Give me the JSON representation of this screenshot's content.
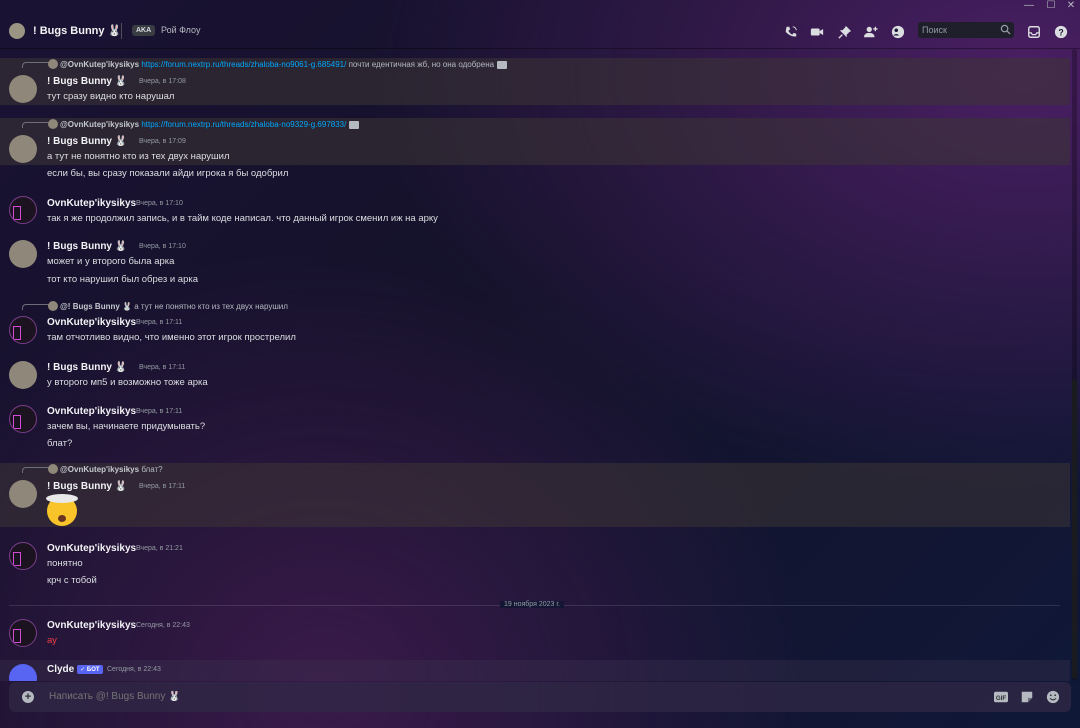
{
  "window": {
    "minimize": "—",
    "maximize": "☐",
    "close": "✕"
  },
  "header": {
    "name": "! Bugs Bunny 🐰",
    "aka_badge": "AKA",
    "alias": "Рой Флоу",
    "icons": [
      "phone-call-icon",
      "video-call-icon",
      "pin-icon",
      "add-friend-icon",
      "profile-icon",
      "inbox-icon",
      "help-icon"
    ],
    "search_placeholder": "Поиск"
  },
  "messages": [
    {
      "reply": {
        "author": "@OvnKutep'ikysikys",
        "link": "https://forum.nextrp.ru/threads/zhaloba-no9061-g.685491/",
        "text": "почти едентичная жб, но она одобрена"
      },
      "author": "!    Bugs Bunny 🐰",
      "time": "Вчера, в 17:08",
      "lines": [
        "тут сразу видно кто нарушал"
      ]
    },
    {
      "reply": {
        "author": "@OvnKutep'ikysikys",
        "link": "https://forum.nextrp.ru/threads/zhaloba-no9329-g.697833/",
        "text": ""
      },
      "author": "!    Bugs Bunny 🐰",
      "time": "Вчера, в 17:09",
      "lines": [
        "а тут не понятно кто из тех двух нарушил",
        "если бы, вы сразу показали айди игрока я бы одобрил"
      ]
    },
    {
      "author": "OvnKutep'ikysikys",
      "time": "Вчера, в 17:10",
      "lines": [
        "так я же продолжил запись, и в тайм коде написал. что данный игрок сменил иж на арку"
      ]
    },
    {
      "author": "!    Bugs Bunny 🐰",
      "time": "Вчера, в 17:10",
      "lines": [
        "может и у второго была арка",
        "тот кто нарушил был обрез и арка"
      ]
    },
    {
      "reply": {
        "author": "@!    Bugs Bunny 🐰",
        "link": "",
        "text": "а тут не понятно кто из тех двух нарушил"
      },
      "author": "OvnKutep'ikysikys",
      "time": "Вчера, в 17:11",
      "lines": [
        "там отчотливо видно, что именно этот игрок прострелил"
      ]
    },
    {
      "author": "!    Bugs Bunny 🐰",
      "time": "Вчера, в 17:11",
      "lines": [
        "у второго мп5 и возможно тоже арка"
      ]
    },
    {
      "author": "OvnKutep'ikysikys",
      "time": "Вчера, в 17:11",
      "lines": [
        "зачем вы, начинаете придумывать?",
        "блат?"
      ]
    },
    {
      "reply": {
        "author": "@OvnKutep'ikysikys",
        "link": "",
        "text": "блат?"
      },
      "author": "!    Bugs Bunny 🐰",
      "time": "Вчера, в 17:11",
      "emoji": "exploding-head-emoji"
    },
    {
      "author": "OvnKutep'ikysikys",
      "time": "Вчера, в 21:21",
      "lines": [
        "понятно",
        "крч с тобой"
      ]
    },
    {
      "author": "OvnKutep'ikysikys",
      "time": "Сегодня, в 22:43",
      "lines": [
        "ау"
      ],
      "text_color": "#f23f43"
    },
    {
      "author": "Clyde",
      "badge": "✓ БОТ",
      "time": "Сегодня, в 22:43"
    }
  ],
  "divider": {
    "label": "19 ноября 2023 г."
  },
  "composer": {
    "placeholder": "Написать @! Bugs Bunny 🐰",
    "add": "+",
    "gif": "GIF"
  },
  "colors": {
    "link": "#00a8fc",
    "error_text": "#f23f43",
    "bot_badge": "#5865f2"
  }
}
